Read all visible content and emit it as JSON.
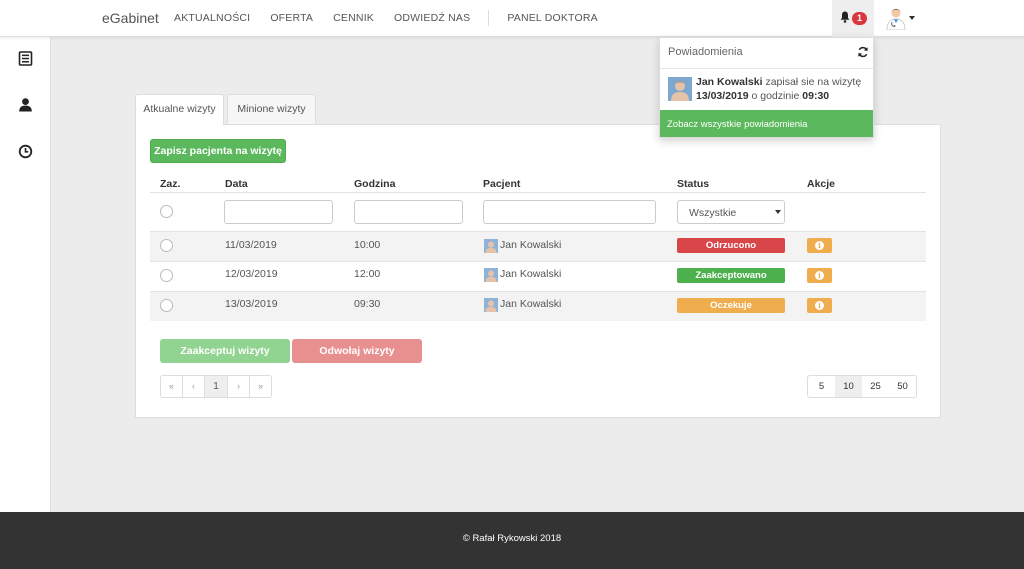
{
  "navbar": {
    "brand": "eGabinet",
    "items": [
      "AKTUALNOŚCI",
      "OFERTA",
      "CENNIK",
      "ODWIEDŹ NAS"
    ],
    "panel_link": "PANEL DOKTORA",
    "notification_count": "1"
  },
  "sidebar": {
    "icons": [
      "list-icon",
      "user-icon",
      "clock-icon"
    ]
  },
  "notifications": {
    "title": "Powiadomienia",
    "item": {
      "name": "Jan Kowalski",
      "action": "zapisał sie na wizytę",
      "date": "13/03/2019",
      "at_text": "o godzinie",
      "time": "09:30"
    },
    "footer": "Zobacz wszystkie powiadomienia"
  },
  "tabs": [
    "Atkualne wizyty",
    "Minione wizyty"
  ],
  "add_button": "Zapisz pacjenta na wizytę",
  "table": {
    "headers": [
      "Zaz.",
      "Data",
      "Godzina",
      "Pacjent",
      "Status",
      "Akcje"
    ],
    "status_filter": "Wszystkie",
    "rows": [
      {
        "date": "11/03/2019",
        "time": "10:00",
        "patient": "Jan Kowalski",
        "status": "Odrzucono",
        "status_color": "#d9464a"
      },
      {
        "date": "12/03/2019",
        "time": "12:00",
        "patient": "Jan Kowalski",
        "status": "Zaakceptowano",
        "status_color": "#4cb04c"
      },
      {
        "date": "13/03/2019",
        "time": "09:30",
        "patient": "Jan Kowalski",
        "status": "Oczekuje",
        "status_color": "#f0ad4e"
      }
    ]
  },
  "actions": {
    "accept": "Zaakceptuj wizyty",
    "cancel": "Odwołaj wizyty"
  },
  "pagination": {
    "pages": [
      "«",
      "‹",
      "1",
      "›",
      "»"
    ],
    "page_sizes": [
      "5",
      "10",
      "25",
      "50"
    ],
    "current_page": "1",
    "current_size": "10"
  },
  "footer": "© Rafał Rykowski 2018"
}
